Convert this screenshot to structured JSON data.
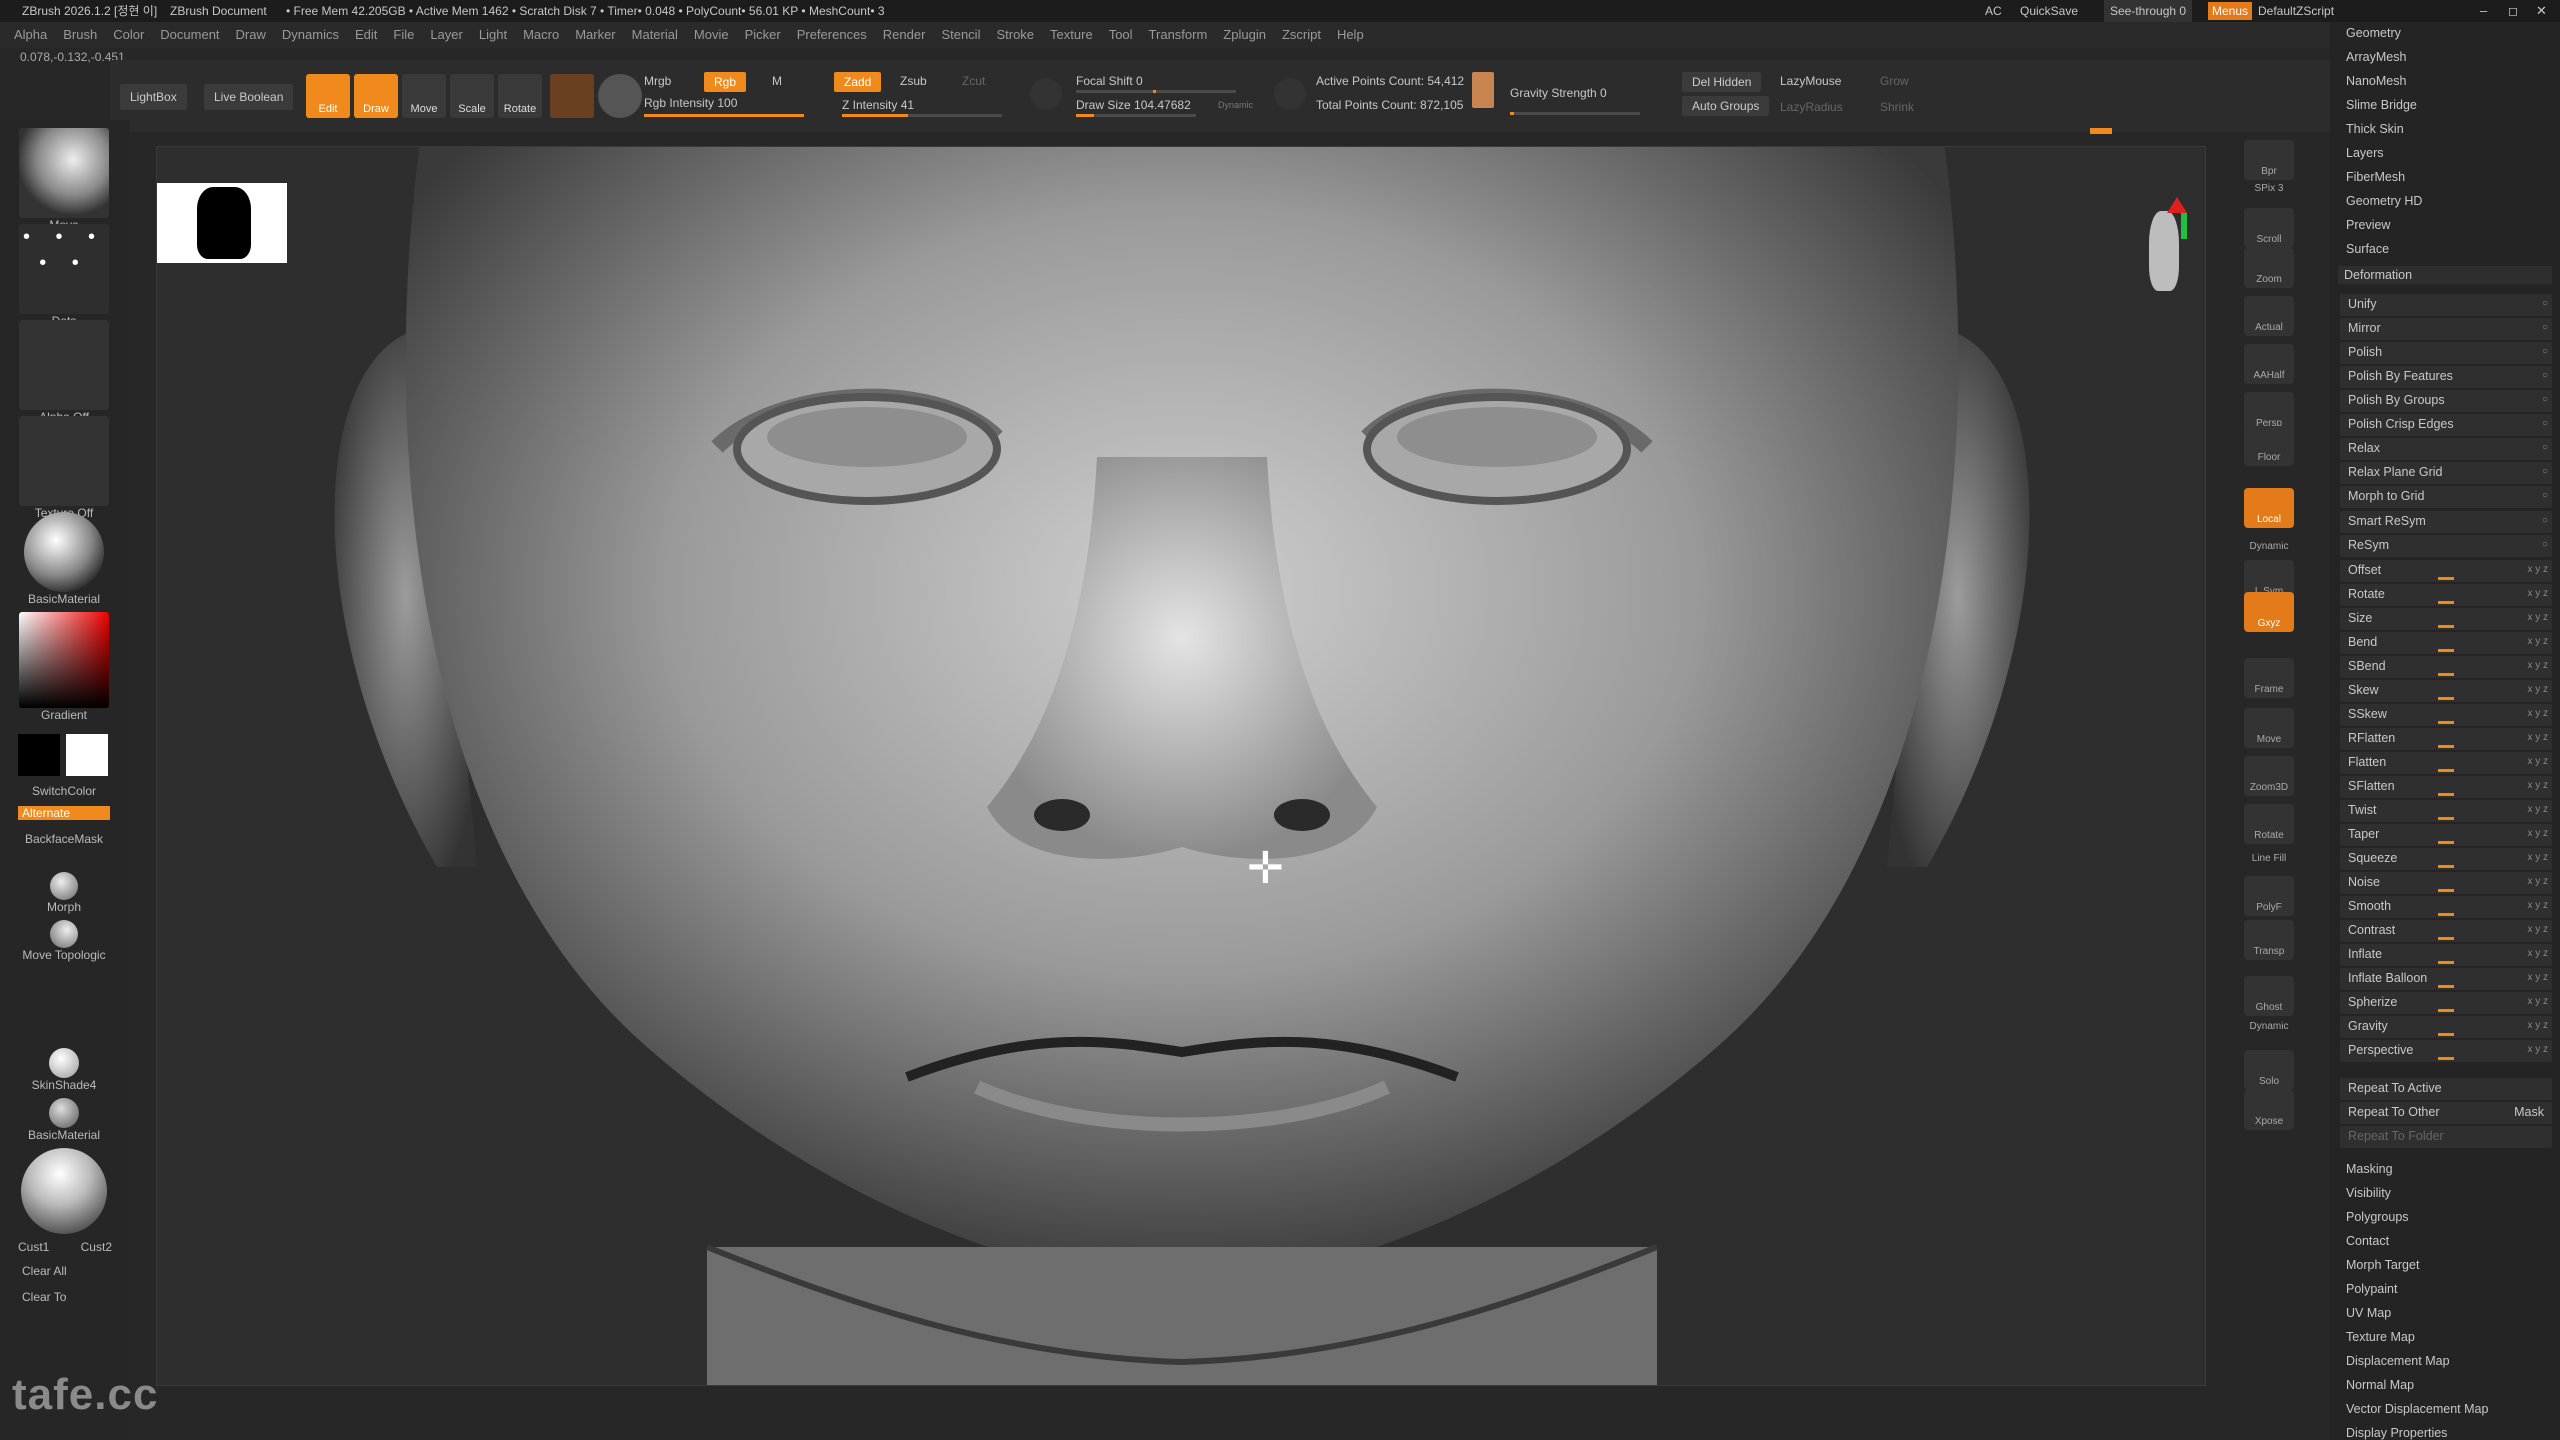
{
  "titlebar": {
    "app": "ZBrush 2026.1.2 [정현 이]",
    "document": "ZBrush Document",
    "stats": "• Free Mem 42.205GB • Active Mem 1462 • Scratch Disk 7 • Timer• 0.048 • PolyCount• 56.01 KP • MeshCount• 3",
    "ac": "AC",
    "quicksave": "QuickSave",
    "seethrough": "See-through  0",
    "menus": "Menus",
    "script": "DefaultZScript"
  },
  "menubar": [
    "Alpha",
    "Brush",
    "Color",
    "Document",
    "Draw",
    "Dynamics",
    "Edit",
    "File",
    "Layer",
    "Light",
    "Macro",
    "Marker",
    "Material",
    "Movie",
    "Picker",
    "Preferences",
    "Render",
    "Stencil",
    "Stroke",
    "Texture",
    "Tool",
    "Transform",
    "Zplugin",
    "Zscript",
    "Help"
  ],
  "coords": "0.078,-0.132,-0.451",
  "toolbar": {
    "lightbox": "LightBox",
    "liveboolean": "Live Boolean",
    "edit": "Edit",
    "draw": "Draw",
    "move": "Move",
    "scale": "Scale",
    "rotate": "Rotate",
    "mrgb": "Mrgb",
    "rgb": "Rgb",
    "m": "M",
    "zadd": "Zadd",
    "zsub": "Zsub",
    "zcut": "Zcut",
    "rgb_intensity": "Rgb Intensity 100",
    "z_intensity": "Z Intensity 41",
    "focal_shift": "Focal Shift 0",
    "draw_size": "Draw Size 104.47682",
    "dynamic": "Dynamic",
    "active_points": "Active Points Count: 54,412",
    "total_points": "Total Points Count: 872,105",
    "gravity": "Gravity Strength 0",
    "del_hidden": "Del Hidden",
    "auto_groups": "Auto Groups",
    "lazymouse": "LazyMouse",
    "lazyradius": "LazyRadius",
    "grow": "Grow",
    "shrink": "Shrink",
    "rgb_intensity_value": 100,
    "z_intensity_value": 41
  },
  "leftpanel": {
    "move": "Move",
    "dots": "Dots",
    "alpha_off": "Alpha Off",
    "texture_off": "Texture Off",
    "basic_material": "BasicMaterial",
    "gradient": "Gradient",
    "switchcolor": "SwitchColor",
    "alternate": "Alternate",
    "backfacemask": "BackfaceMask",
    "morph": "Morph",
    "move_topologic": "Move Topologic",
    "skinshade4": "SkinShade4",
    "basic_material2": "BasicMaterial",
    "cust1": "Cust1",
    "cust2": "Cust2",
    "clear_all": "Clear All",
    "clear_to": "Clear To"
  },
  "righticons": [
    "Bpr",
    "SPix 3",
    "Scroll",
    "Zoom",
    "Actual",
    "AAHalf",
    "Persp",
    "Floor",
    "Local",
    "Dynamic",
    "L.Sym",
    "Gxyz",
    "Frame",
    "Move",
    "Zoom3D",
    "Rotate",
    "Line Fill",
    "PolyF",
    "Transp",
    "Ghost",
    "Dynamic",
    "Solo",
    "Xpose"
  ],
  "rightpanel": {
    "top_items": [
      "Geometry",
      "ArrayMesh",
      "NanoMesh",
      "Slime Bridge",
      "Thick Skin",
      "Layers",
      "FiberMesh",
      "Geometry HD",
      "Preview",
      "Surface",
      "Deformation"
    ],
    "deform_items": [
      "Unify",
      "Mirror",
      "Polish",
      "Polish By Features",
      "Polish By Groups",
      "Polish Crisp Edges",
      "Relax",
      "Relax Plane Grid",
      "Morph to Grid",
      "Smart ReSym",
      "ReSym",
      "Offset",
      "Rotate",
      "Size",
      "Bend",
      "SBend",
      "Skew",
      "SSkew",
      "RFlatten",
      "Flatten",
      "SFlatten",
      "Twist",
      "Taper",
      "Squeeze",
      "Noise",
      "Smooth",
      "Contrast",
      "Inflate",
      "Inflate Balloon",
      "Spherize",
      "Gravity",
      "Perspective"
    ],
    "repeat_active": "Repeat To Active",
    "repeat_other": "Repeat To Other",
    "mask": "Mask",
    "repeat_folder": "Repeat To Folder",
    "bottom_items": [
      "Masking",
      "Visibility",
      "Polygroups",
      "Contact",
      "Morph Target",
      "Polypaint",
      "UV Map",
      "Texture Map",
      "Displacement Map",
      "Normal Map",
      "Vector Displacement Map",
      "Display Properties"
    ]
  },
  "watermark": "tafe.cc",
  "colors": {
    "accent": "#f08a1c",
    "panel": "#262626",
    "bg": "#2e2e2e"
  }
}
